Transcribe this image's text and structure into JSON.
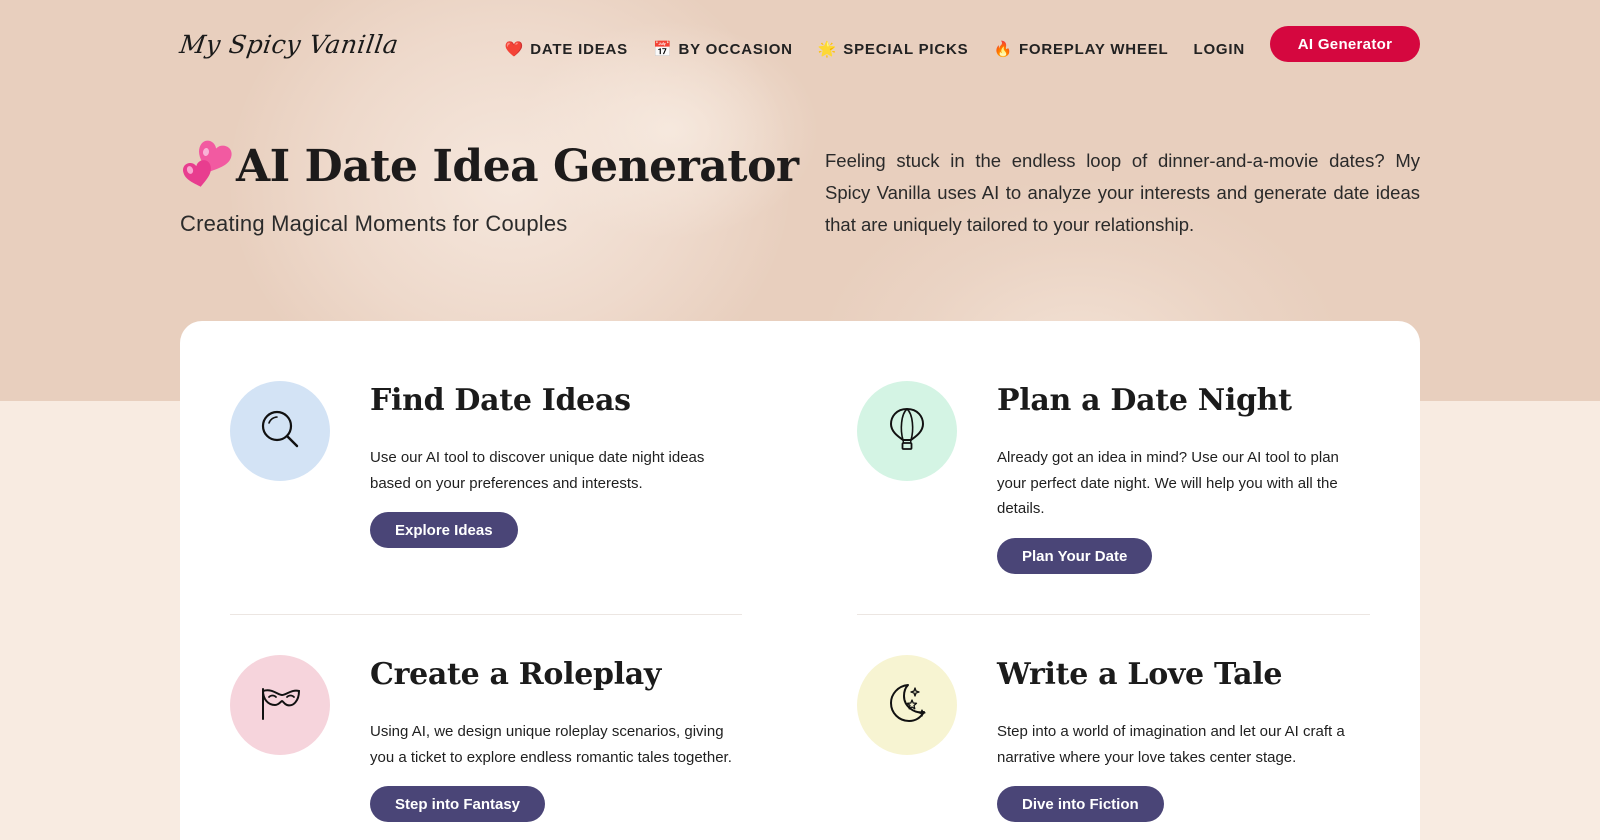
{
  "header": {
    "logo": "My Spicy Vanilla",
    "nav": [
      {
        "emoji": "❤️",
        "icon": "heart-icon",
        "label": "DATE IDEAS"
      },
      {
        "emoji": "📅",
        "icon": "calendar-icon",
        "label": "BY OCCASION"
      },
      {
        "emoji": "🌟",
        "icon": "star-icon",
        "label": "SPECIAL PICKS"
      },
      {
        "emoji": "🔥",
        "icon": "fire-icon",
        "label": "FOREPLAY WHEEL"
      },
      {
        "emoji": "",
        "icon": "",
        "label": "LOGIN"
      }
    ],
    "cta_label": "AI Generator"
  },
  "hero": {
    "title": "AI Date Idea Generator",
    "subtitle": "Creating Magical Moments for Couples",
    "description": "Feeling stuck in the endless loop of dinner-and-a-movie dates? My Spicy Vanilla uses AI to analyze your interests and generate date ideas that are uniquely tailored to your relationship."
  },
  "features": [
    {
      "title": "Find Date Ideas",
      "description": "Use our AI tool to discover unique date night ideas based on your preferences and interests.",
      "button": "Explore Ideas",
      "icon": "search-icon",
      "color": "#d3e3f5"
    },
    {
      "title": "Plan a Date Night",
      "description": "Already got an idea in mind? Use our AI tool to plan your perfect date night. We will help you with all the details.",
      "button": "Plan Your Date",
      "icon": "hot-air-balloon-icon",
      "color": "#d4f4e4"
    },
    {
      "title": "Create a Roleplay",
      "description": "Using AI, we design unique roleplay scenarios, giving you a ticket to explore endless romantic tales together.",
      "button": "Step into Fantasy",
      "icon": "mask-icon",
      "color": "#f6d4dc"
    },
    {
      "title": "Write a Love Tale",
      "description": "Step into a world of imagination and let our AI craft a narrative where your love takes center stage.",
      "button": "Dive into Fiction",
      "icon": "moon-stars-icon",
      "color": "#f7f4d2"
    }
  ],
  "colors": {
    "hero_bg": "#e8cfbe",
    "page_bg": "#f8ebe1",
    "accent_red": "#d5073f",
    "button_purple": "#4a4577"
  }
}
